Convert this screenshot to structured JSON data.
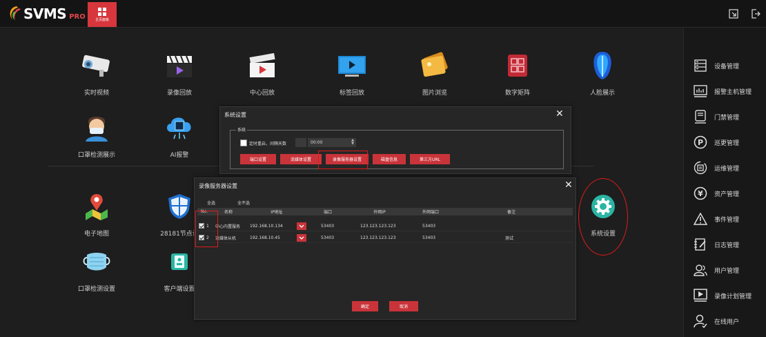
{
  "app": {
    "logo_text": "SVMS",
    "logo_suffix": "PRO",
    "home_tab_label": "主页面板"
  },
  "main_tiles": [
    {
      "label": "实时视频",
      "icon": "camera-icon"
    },
    {
      "label": "录像回放",
      "icon": "video-playback-icon"
    },
    {
      "label": "中心回放",
      "icon": "clapperboard-icon"
    },
    {
      "label": "标签回放",
      "icon": "tag-playback-icon"
    },
    {
      "label": "图片浏览",
      "icon": "photo-icon"
    },
    {
      "label": "数字矩阵",
      "icon": "matrix-icon"
    },
    {
      "label": "人脸展示",
      "icon": "face-icon"
    },
    {
      "label": "口罩检测展示",
      "icon": "mask-person-icon"
    },
    {
      "label": "AI报警",
      "icon": "ai-chip-icon"
    },
    {
      "label": "电子地图",
      "icon": "map-pin-icon"
    },
    {
      "label": "28181节点设",
      "icon": "shield-icon"
    },
    {
      "label": "系统设置",
      "icon": "gear-icon"
    },
    {
      "label": "口罩检测设置",
      "icon": "mask-icon"
    },
    {
      "label": "客户端设置",
      "icon": "client-settings-icon"
    }
  ],
  "sidebar": {
    "items": [
      {
        "label": "设备管理",
        "icon": "device-icon"
      },
      {
        "label": "报警主机管理",
        "icon": "alarm-host-icon"
      },
      {
        "label": "门禁管理",
        "icon": "access-control-icon"
      },
      {
        "label": "巡更管理",
        "icon": "patrol-icon"
      },
      {
        "label": "运维管理",
        "icon": "maintenance-icon"
      },
      {
        "label": "资产管理",
        "icon": "asset-icon"
      },
      {
        "label": "事件管理",
        "icon": "event-warning-icon"
      },
      {
        "label": "日志管理",
        "icon": "log-icon"
      },
      {
        "label": "用户管理",
        "icon": "users-icon"
      },
      {
        "label": "录像计划管理",
        "icon": "record-plan-icon"
      },
      {
        "label": "在线用户",
        "icon": "online-user-icon"
      }
    ]
  },
  "system_dialog": {
    "title": "系统设置",
    "group_label": "系统",
    "timed_restart_label": "定时重启，间隔天数",
    "interval_days": "",
    "restart_time": "00:00",
    "buttons": [
      "端口设置",
      "流媒体设置",
      "录像服务器设置",
      "磁盘信息",
      "第三方URL"
    ]
  },
  "record_dialog": {
    "title": "录像服务器设置",
    "select_all": "全选",
    "select_none": "全不选",
    "columns": [
      "No.",
      "名称",
      "IP地址",
      "端口",
      "外网IP",
      "外网端口",
      "备注"
    ],
    "rows": [
      {
        "checked": true,
        "no": "1",
        "name": "中心内置服务",
        "ip": "192.168.10.134",
        "port": "53403",
        "wan_ip": "123.123.123.123",
        "wan_port": "53403",
        "note": ""
      },
      {
        "checked": true,
        "no": "2",
        "name": "流媒体从机",
        "ip": "192.168.10.45",
        "port": "53403",
        "wan_ip": "123.123.123.123",
        "wan_port": "53403",
        "note": "测试"
      }
    ],
    "ok_label": "确定",
    "cancel_label": "取消"
  },
  "colors": {
    "accent_red": "#c9343a",
    "annotation_red": "#e21b1b",
    "background": "#1e1e1e"
  }
}
